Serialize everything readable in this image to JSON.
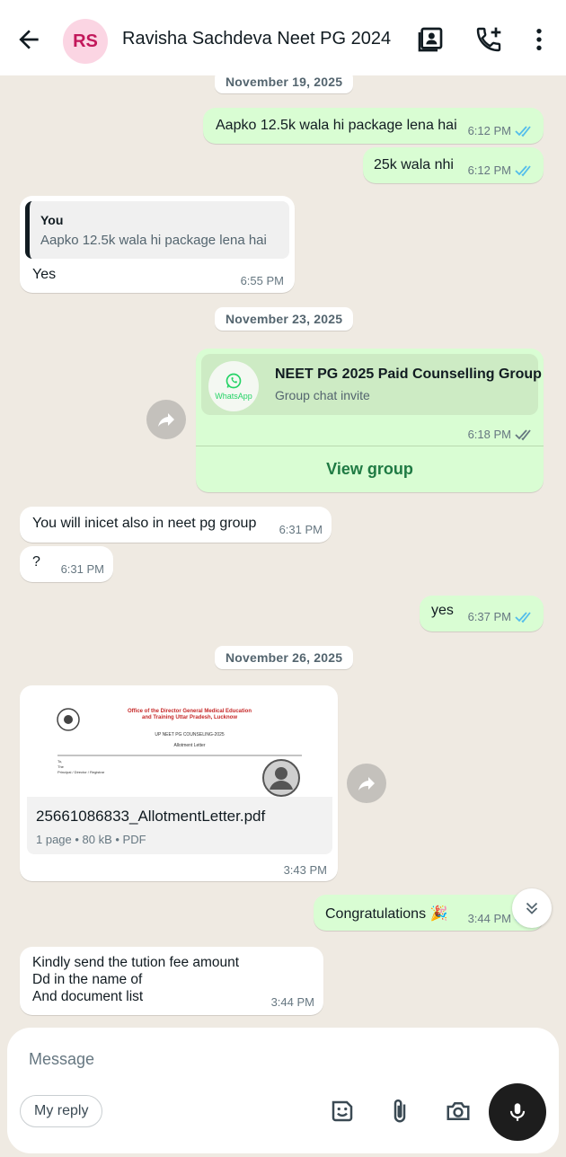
{
  "header": {
    "avatar_initials": "RS",
    "contact_name": "Ravisha Sachdeva Neet PG 2024"
  },
  "dates": {
    "d1": "November 19, 2025",
    "d2": "November 23, 2025",
    "d3": "November 26, 2025"
  },
  "messages": {
    "m1": {
      "text": "Aapko 12.5k wala hi package lena hai",
      "time": "6:12 PM",
      "status": "read"
    },
    "m2": {
      "text": "25k wala nhi",
      "time": "6:12 PM",
      "status": "read"
    },
    "m3": {
      "quote_author": "You",
      "quote_text": "Aapko 12.5k wala hi package lena hai",
      "text": "Yes",
      "time": "6:55 PM"
    },
    "m4": {
      "logo_label": "WhatsApp",
      "title": "NEET PG 2025 Paid Counselling Group",
      "subtitle": "Group chat invite",
      "time": "6:18 PM",
      "status": "delivered",
      "action": "View group"
    },
    "m5": {
      "text": "You will inicet also in neet pg group",
      "time": "6:31 PM"
    },
    "m6": {
      "text": "?",
      "time": "6:31 PM"
    },
    "m7": {
      "text": "yes",
      "time": "6:37 PM",
      "status": "read"
    },
    "m8": {
      "preview_header": "Office of the Director General Medical Education and Training Uttar Pradesh, Lucknow",
      "preview_sub": "UP NEET PG COUNSELING-2025",
      "preview_title": "Allotment Letter",
      "preview_lines": [
        "To,",
        "The",
        "Principal / Director / Registrar"
      ],
      "file_name": "25661086833_AllotmentLetter.pdf",
      "file_meta": "1 page • 80 kB • PDF",
      "time": "3:43 PM"
    },
    "m9": {
      "text": "Congratulations 🎉",
      "time": "3:44 PM",
      "status": "read"
    },
    "m10": {
      "line1": "Kindly send the tution fee amount",
      "line2": "Dd in the name of",
      "line3": "And document list",
      "time": "3:44 PM"
    }
  },
  "composer": {
    "placeholder": "Message",
    "my_reply": "My reply"
  },
  "colors": {
    "outgoing_bubble": "#d9fdd3",
    "incoming_bubble": "#ffffff",
    "read_tick": "#53bdeb",
    "wallpaper": "#efeae2"
  }
}
